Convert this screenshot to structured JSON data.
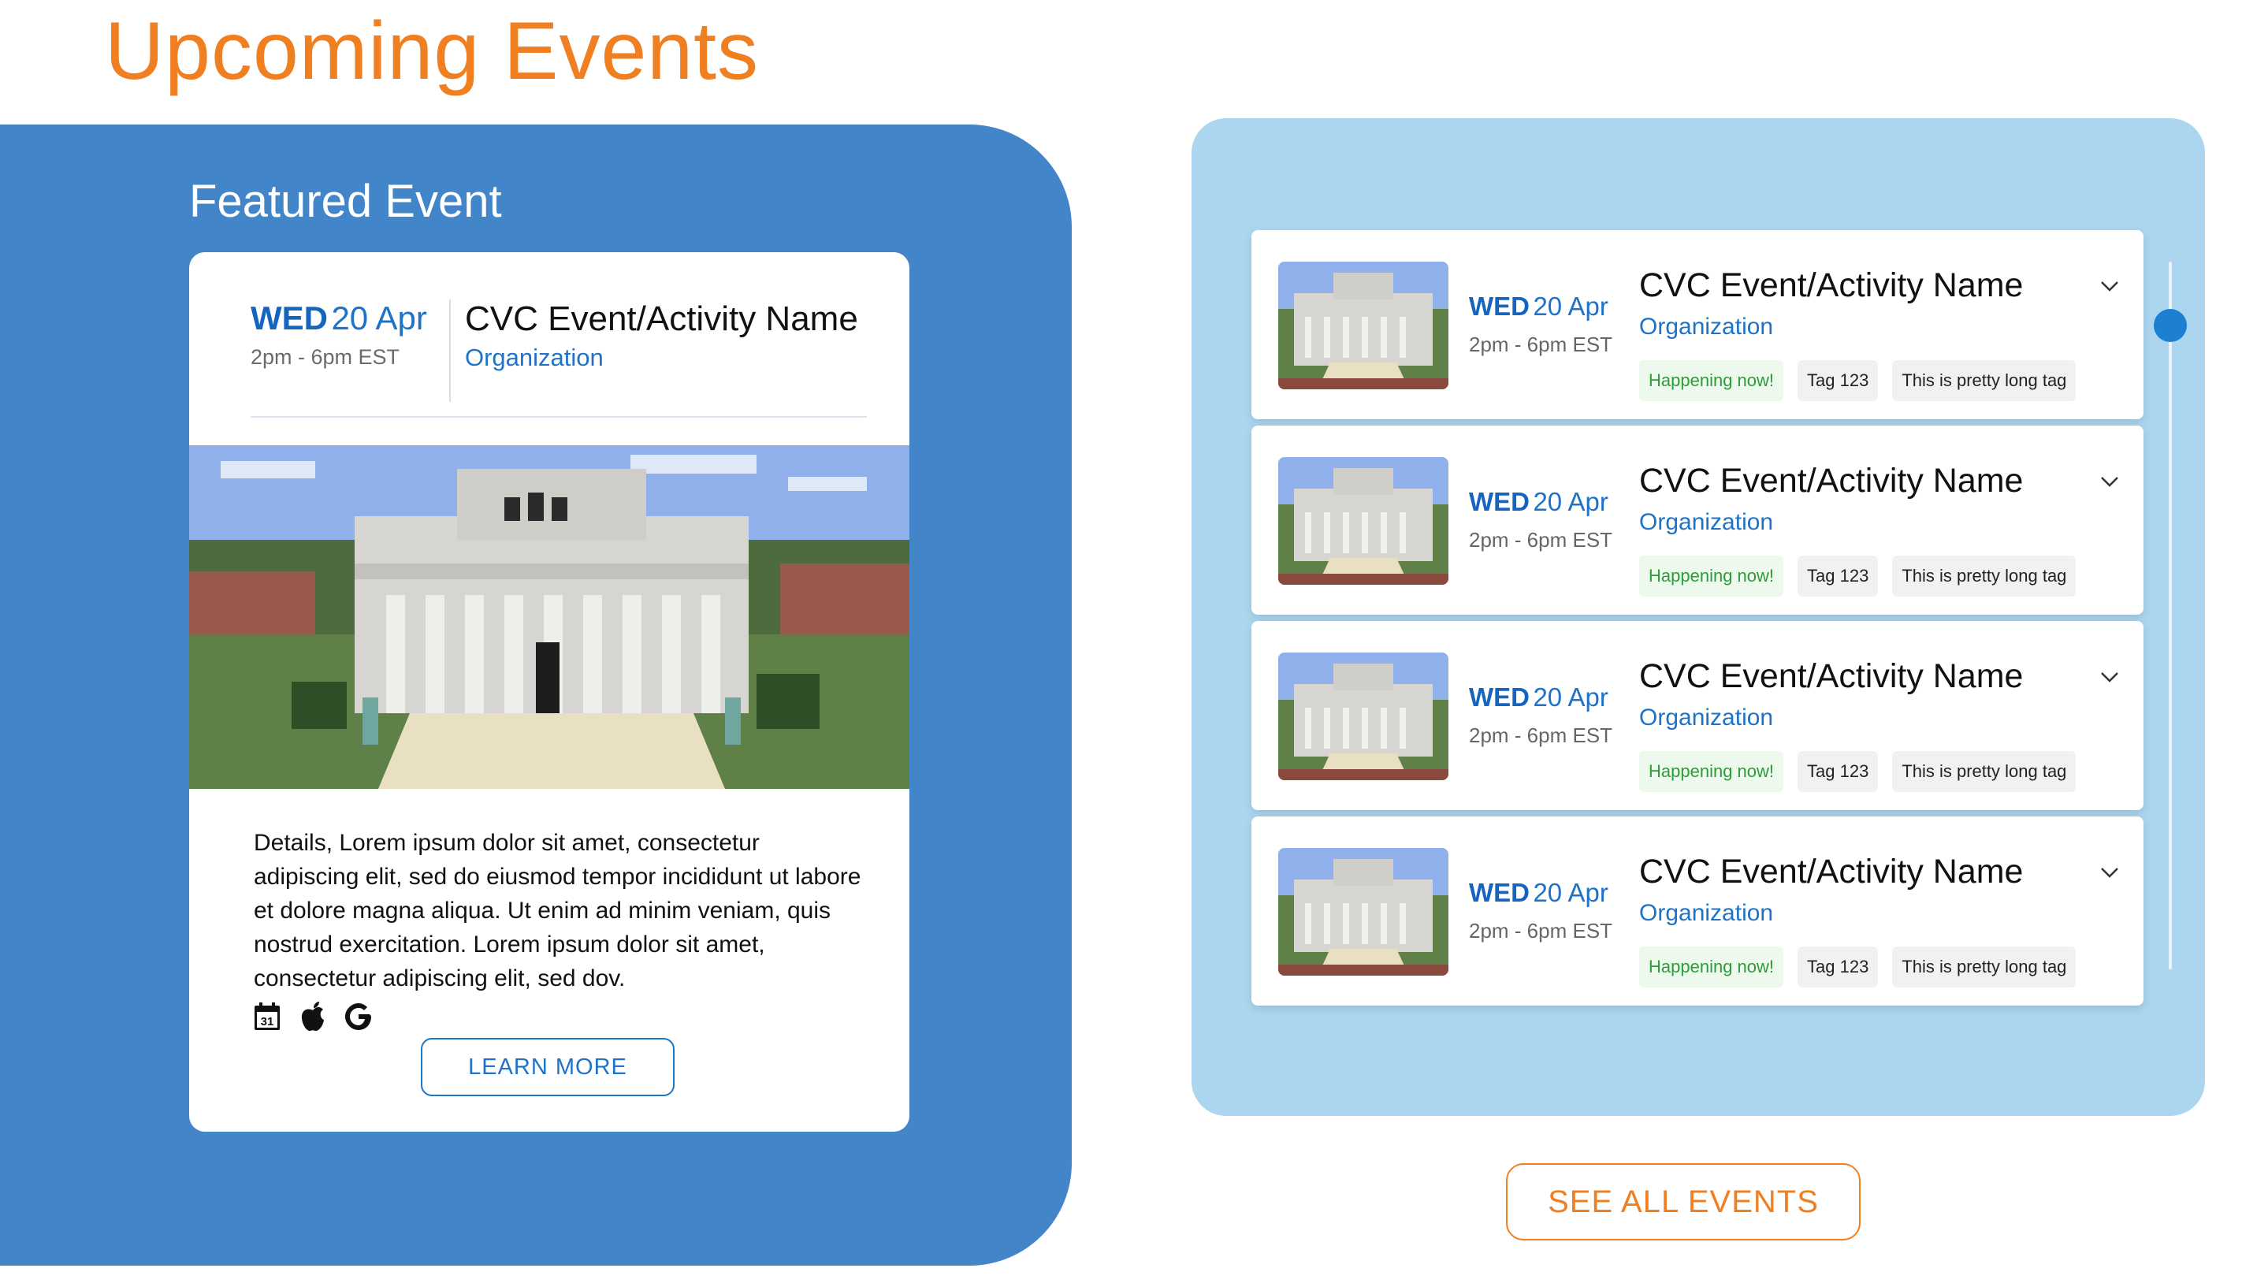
{
  "page": {
    "title": "Upcoming Events"
  },
  "featured": {
    "section_label": "Featured Event",
    "day": "WED",
    "date": "20 Apr",
    "time": "2pm - 6pm EST",
    "title": "CVC Event/Activity Name",
    "organization": "Organization",
    "details": "Details, Lorem ipsum dolor sit amet, consectetur adipiscing elit, sed do eiusmod tempor incididunt ut labore et dolore magna aliqua. Ut enim ad minim veniam, quis nostrud exercitation. Lorem ipsum dolor sit amet, consectetur adipiscing elit, sed dov.",
    "calendar_icon_text": "31",
    "icons": [
      "calendar-icon",
      "apple-icon",
      "google-icon"
    ],
    "learn_more_label": "LEARN MORE"
  },
  "events": [
    {
      "day": "WED",
      "date": "20 Apr",
      "time": "2pm - 6pm EST",
      "title": "CVC Event/Activity Name",
      "organization": "Organization",
      "tags": [
        "Happening now!",
        "Tag 123",
        "This is pretty long tag"
      ]
    },
    {
      "day": "WED",
      "date": "20 Apr",
      "time": "2pm - 6pm EST",
      "title": "CVC Event/Activity Name",
      "organization": "Organization",
      "tags": [
        "Happening now!",
        "Tag 123",
        "This is pretty long tag"
      ]
    },
    {
      "day": "WED",
      "date": "20 Apr",
      "time": "2pm - 6pm EST",
      "title": "CVC Event/Activity Name",
      "organization": "Organization",
      "tags": [
        "Happening now!",
        "Tag 123",
        "This is pretty long tag"
      ]
    },
    {
      "day": "WED",
      "date": "20 Apr",
      "time": "2pm - 6pm EST",
      "title": "CVC Event/Activity Name",
      "organization": "Organization",
      "tags": [
        "Happening now!",
        "Tag 123",
        "This is pretty long tag"
      ]
    }
  ],
  "see_all_label": "SEE ALL EVENTS",
  "colors": {
    "accent_orange": "#f07f22",
    "featured_blue": "#4285c9",
    "list_blue": "#acd6f0",
    "link_blue": "#1e73c8",
    "live_green": "#2d9b3a"
  }
}
